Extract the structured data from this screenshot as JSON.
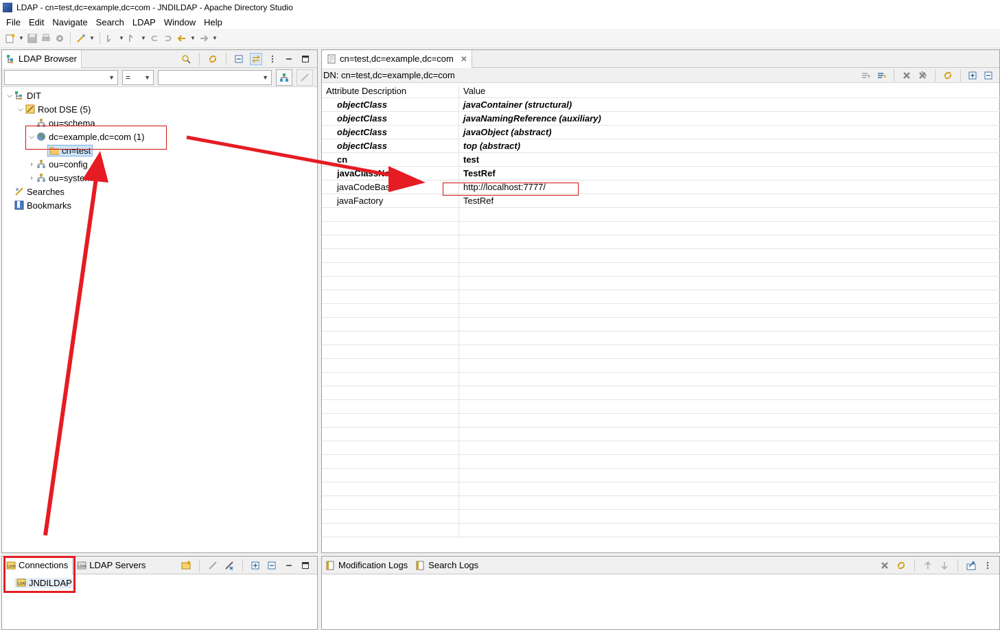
{
  "window": {
    "title": "LDAP - cn=test,dc=example,dc=com - JNDILDAP - Apache Directory Studio"
  },
  "menu": [
    "File",
    "Edit",
    "Navigate",
    "Search",
    "LDAP",
    "Window",
    "Help"
  ],
  "browser": {
    "tab_label": "LDAP Browser",
    "filter_operator": "=",
    "tree": [
      {
        "label": "DIT",
        "icon": "dit-icon",
        "depth": 0,
        "expanded": true
      },
      {
        "label": "Root DSE (5)",
        "icon": "root-dse-icon",
        "depth": 1,
        "expanded": true
      },
      {
        "label": "ou=schema",
        "icon": "ou-icon",
        "depth": 2
      },
      {
        "label": "dc=example,dc=com (1)",
        "icon": "globe-icon",
        "depth": 2,
        "expanded": true
      },
      {
        "label": "cn=test",
        "icon": "folder-icon",
        "depth": 3,
        "selected": true
      },
      {
        "label": "ou=config",
        "icon": "ou-icon",
        "depth": 2,
        "collapsed": true
      },
      {
        "label": "ou=system",
        "icon": "ou-icon",
        "depth": 2,
        "collapsed": true
      },
      {
        "label": "Searches",
        "icon": "searches-icon",
        "depth": 1
      },
      {
        "label": "Bookmarks",
        "icon": "bookmarks-icon",
        "depth": 1
      }
    ]
  },
  "editor": {
    "tab_label": "cn=test,dc=example,dc=com",
    "dn_label": "DN: cn=test,dc=example,dc=com",
    "columns": [
      "Attribute Description",
      "Value"
    ],
    "rows": [
      {
        "attr": "objectClass",
        "value": "javaContainer (structural)",
        "style": "bi"
      },
      {
        "attr": "objectClass",
        "value": "javaNamingReference (auxiliary)",
        "style": "bi"
      },
      {
        "attr": "objectClass",
        "value": "javaObject (abstract)",
        "style": "bi"
      },
      {
        "attr": "objectClass",
        "value": "top (abstract)",
        "style": "bi"
      },
      {
        "attr": "cn",
        "value": "test",
        "style": "b"
      },
      {
        "attr": "javaClassName",
        "value": "TestRef",
        "style": "b"
      },
      {
        "attr": "javaCodeBase",
        "value": "http://localhost:7777/",
        "style": ""
      },
      {
        "attr": "javaFactory",
        "value": "TestRef",
        "style": ""
      }
    ]
  },
  "connections": {
    "tabs": [
      "Connections",
      "LDAP Servers"
    ],
    "items": [
      "JNDILDAP"
    ]
  },
  "logs": {
    "tabs": [
      "Modification Logs",
      "Search Logs"
    ]
  },
  "colors": {
    "annotation_red": "#e51c23",
    "selection": "#cce4f7",
    "panel_border": "#a0a0a0"
  }
}
